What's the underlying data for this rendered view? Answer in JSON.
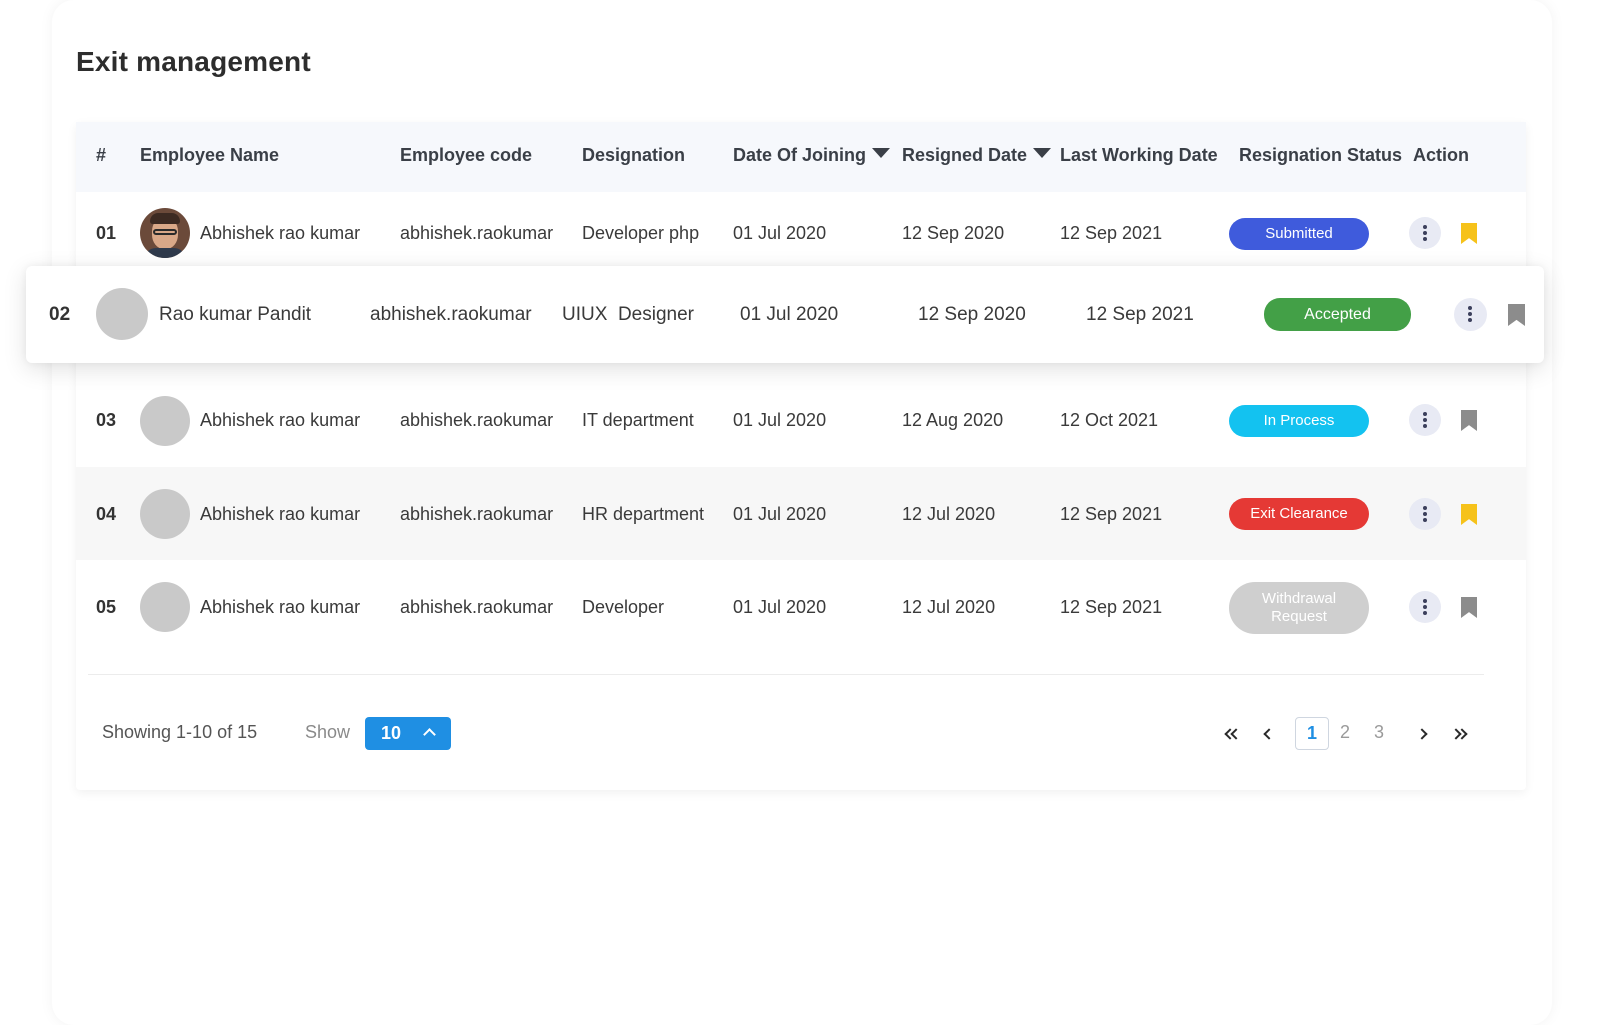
{
  "page": {
    "title": "Exit management"
  },
  "table": {
    "headers": {
      "num": "#",
      "name": "Employee Name",
      "code": "Employee code",
      "designation": "Designation",
      "joining": "Date Of Joining",
      "resigned": "Resigned Date",
      "last": "Last Working Date",
      "status": "Resignation Status",
      "action": "Action"
    },
    "rows": [
      {
        "num": "01",
        "name": "Abhishek rao kumar",
        "code": "abhishek.raokumar",
        "designation": "Developer php",
        "joining": "01 Jul 2020",
        "resigned": "12 Sep 2020",
        "last": "12 Sep 2021",
        "status": "Submitted",
        "status_color": "#3f5bdc",
        "bookmark_color": "#f6c21a"
      },
      {
        "num": "02",
        "name": "Rao kumar Pandit",
        "code": "abhishek.raokumar",
        "designation": "UIUX  Designer",
        "joining": "01 Jul 2020",
        "resigned": "12 Sep 2020",
        "last": "12 Sep 2021",
        "status": "Accepted",
        "status_color": "#43a047",
        "bookmark_color": "#8c8c8c"
      },
      {
        "num": "03",
        "name": "Abhishek rao kumar",
        "code": "abhishek.raokumar",
        "designation": "IT department",
        "joining": "01 Jul 2020",
        "resigned": "12 Aug 2020",
        "last": "12 Oct 2021",
        "status": "In Process",
        "status_color": "#13c2f0",
        "bookmark_color": "#8c8c8c"
      },
      {
        "num": "04",
        "name": "Abhishek rao kumar",
        "code": "abhishek.raokumar",
        "designation": "HR department",
        "joining": "01 Jul 2020",
        "resigned": "12 Jul 2020",
        "last": "12 Sep 2021",
        "status": "Exit Clearance",
        "status_color": "#e53935",
        "bookmark_color": "#f6c21a"
      },
      {
        "num": "05",
        "name": "Abhishek rao kumar",
        "code": "abhishek.raokumar",
        "designation": "Developer",
        "joining": "01 Jul 2020",
        "resigned": "12 Jul 2020",
        "last": "12 Sep 2021",
        "status_line1": "Withdrawal",
        "status_line2": "Request",
        "status_color": "#cfcfcf",
        "bookmark_color": "#8c8c8c"
      }
    ]
  },
  "footer": {
    "showing": "Showing 1-10 of 15",
    "show_label": "Show",
    "page_size": "10",
    "pages": [
      "1",
      "2",
      "3"
    ],
    "current_page": 1
  },
  "icons": {
    "kebab": "more-vertical-icon",
    "bookmark": "bookmark-icon",
    "first": "double-chevron-left-icon",
    "prev": "chevron-left-icon",
    "next": "chevron-right-icon",
    "last": "double-chevron-right-icon",
    "sort": "caret-down-icon"
  }
}
